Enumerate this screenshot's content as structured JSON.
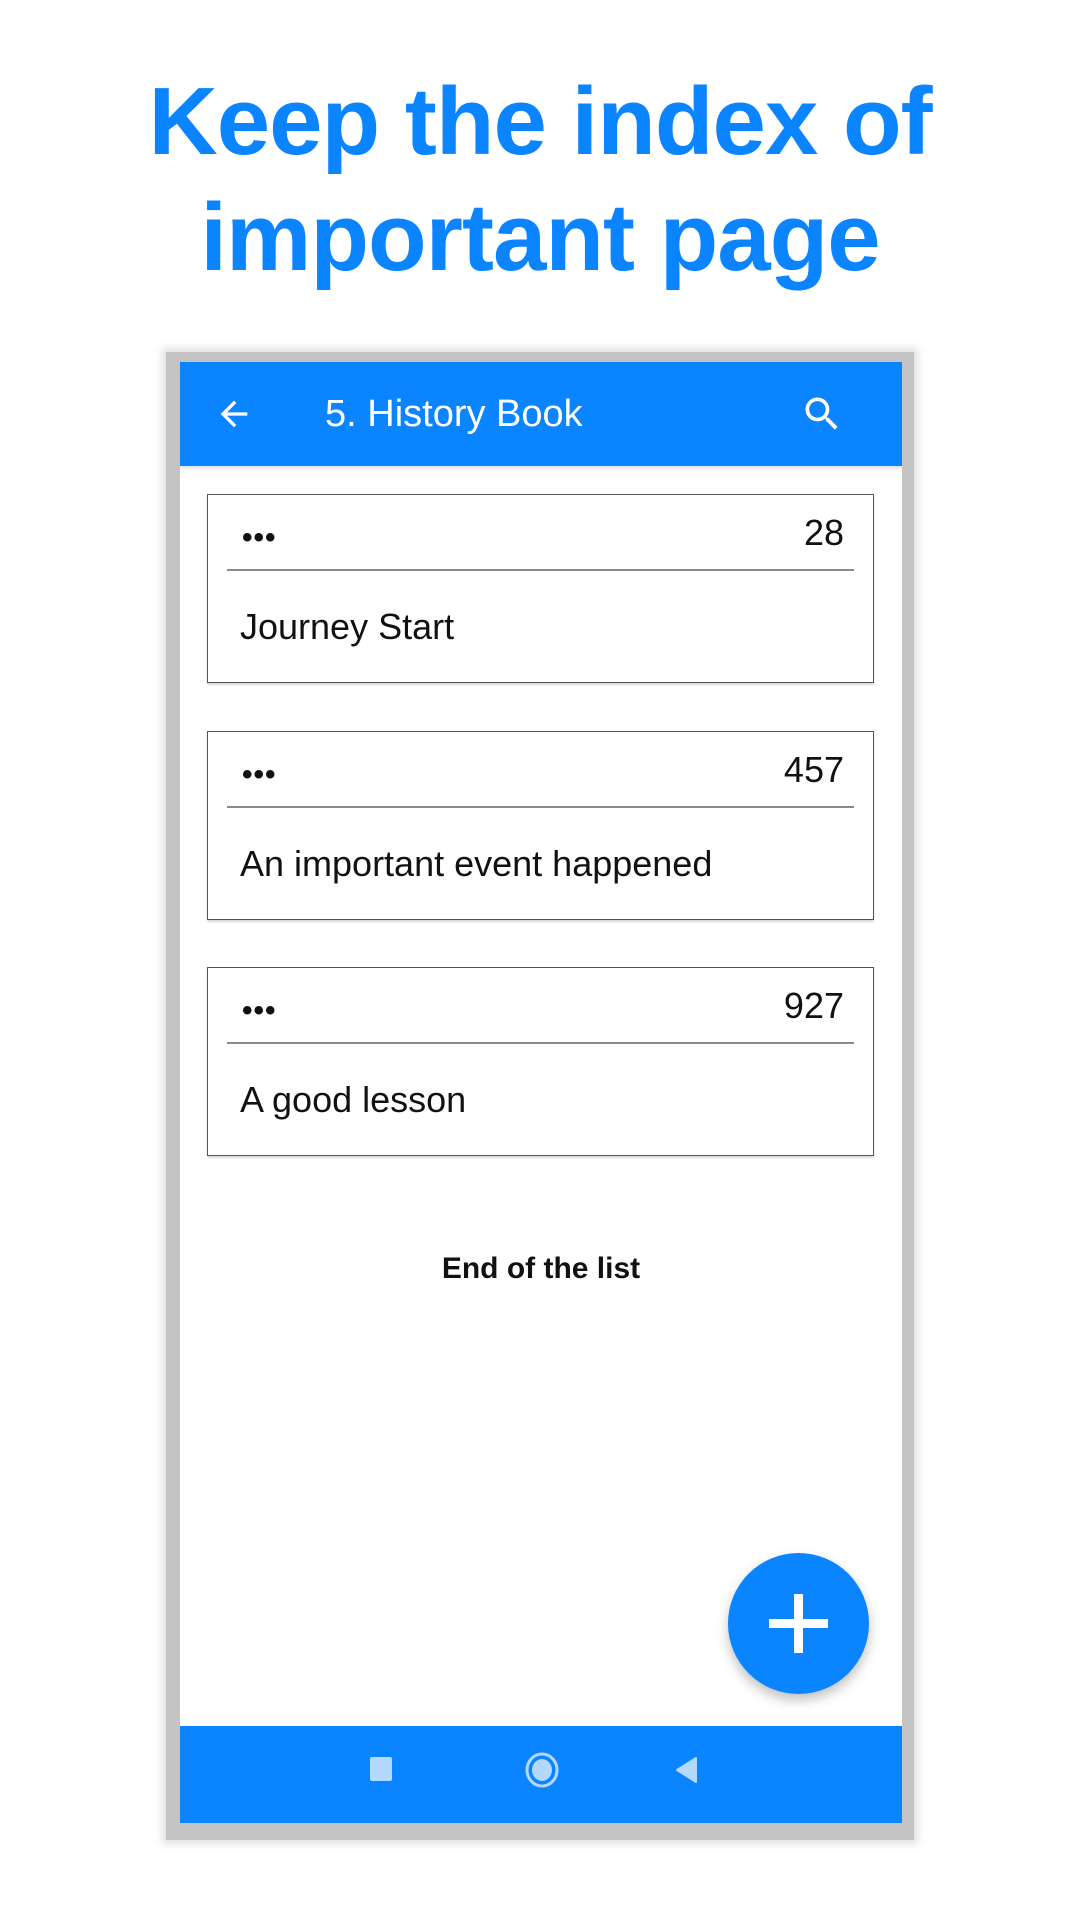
{
  "headline": {
    "line1": "Keep the index of",
    "line2": "important page"
  },
  "app": {
    "title": "5. History Book",
    "icons": {
      "back": "arrow-left-icon",
      "search": "search-icon",
      "add": "plus-icon"
    }
  },
  "bookmarks": [
    {
      "menu": "•••",
      "page": "28",
      "label": "Journey Start"
    },
    {
      "menu": "•••",
      "page": "457",
      "label": "An important event happened"
    },
    {
      "menu": "•••",
      "page": "927",
      "label": "A good lesson"
    }
  ],
  "footer_text": "End of the list",
  "navbar": {
    "icons": [
      "recents-square-icon",
      "home-circle-icon",
      "back-triangle-icon"
    ]
  },
  "colors": {
    "accent": "#0A84FF",
    "nav_icon": "#B3D9FF"
  }
}
